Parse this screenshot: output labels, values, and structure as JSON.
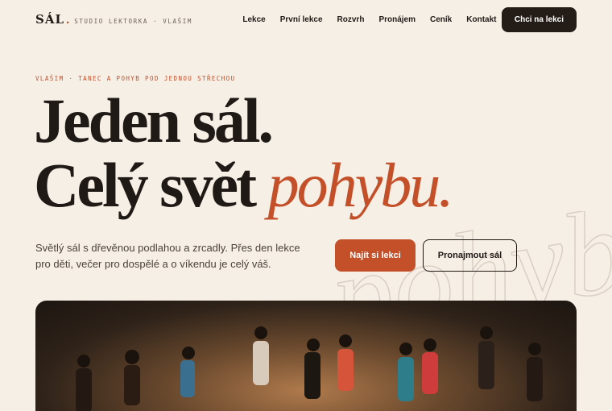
{
  "nav": {
    "brand": "SÁL",
    "brand_dot": ".",
    "tagline": "STUDIO LEKTORKA · VLAŠIM",
    "links": [
      "Lekce",
      "První lekce",
      "Rozvrh",
      "Pronájem",
      "Ceník",
      "Kontakt"
    ],
    "cta": "Chci na lekci"
  },
  "hero": {
    "eyebrow": "VLAŠIM · TANEC A POHYB POD JEDNOU STŘECHOU",
    "line1": "Jeden sál.",
    "line2_main": "Celý svět",
    "line2_accent": "pohybu.",
    "lead": "Světlý sál s dřevěnou podlahou a zrcadly. Přes den lekce pro děti, večer pro dospělé a o víkendu je celý váš.",
    "primary_cta": "Najít si lekci",
    "secondary_cta": "Pronajmout sál",
    "watermark": "pohyb"
  },
  "colors": {
    "background": "#f6efe6",
    "accent": "#c4502a",
    "dark": "#241c16"
  }
}
